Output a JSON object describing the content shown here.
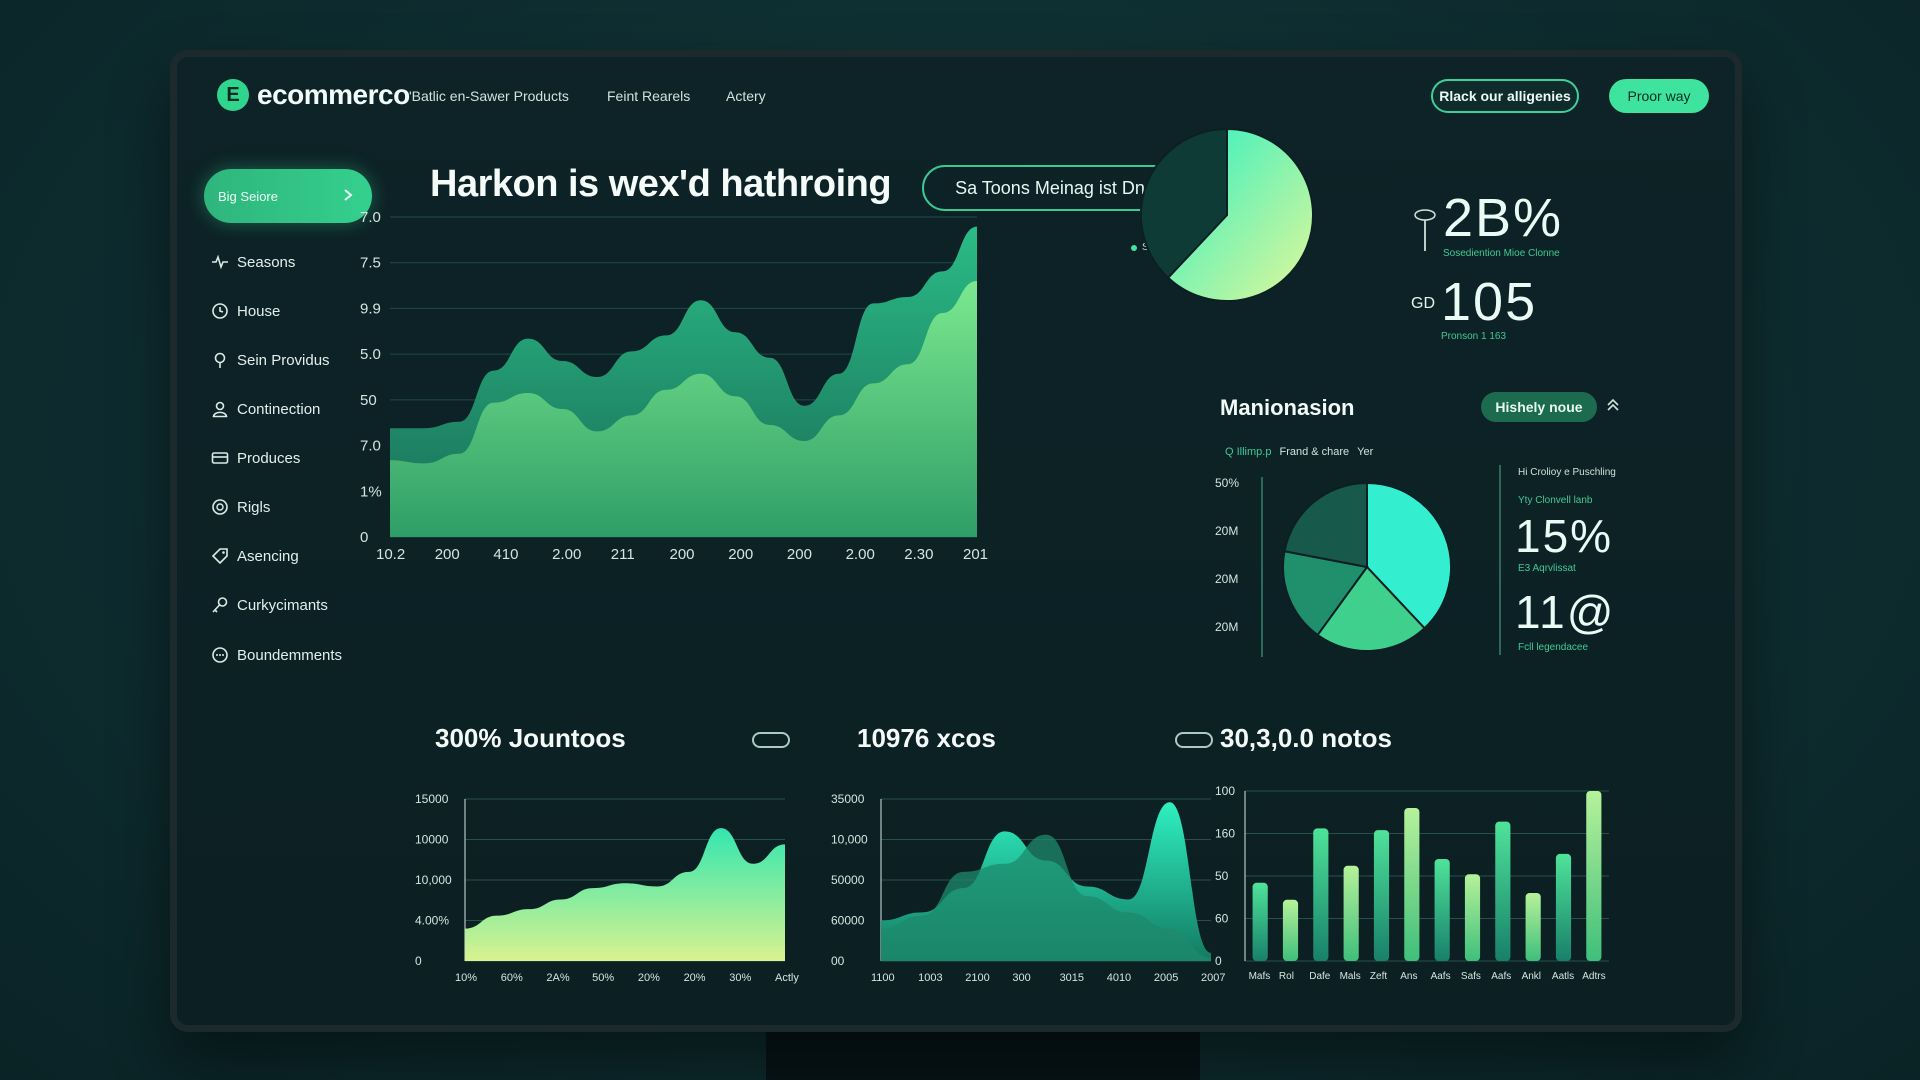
{
  "app": {
    "logo_mark": "E",
    "name": "ecommerco"
  },
  "nav": [
    "'Batlic en-Sawer Products",
    "Feint Rearels",
    "Actery"
  ],
  "header_buttons": {
    "outline": "Rlack our alligenies",
    "solid": "Proor way"
  },
  "sidebar": {
    "cta": "Big Seiore",
    "items": [
      {
        "label": "Seasons",
        "icon": "heartbeat-icon"
      },
      {
        "label": "House",
        "icon": "clock-icon"
      },
      {
        "label": "Sein Providus",
        "icon": "pin-icon"
      },
      {
        "label": "Continection",
        "icon": "user-icon"
      },
      {
        "label": "Produces",
        "icon": "card-icon"
      },
      {
        "label": "Rigls",
        "icon": "badge-icon"
      },
      {
        "label": "Asencing",
        "icon": "tag-icon"
      },
      {
        "label": "Curkycimants",
        "icon": "key-icon"
      },
      {
        "label": "Boundemments",
        "icon": "chat-icon"
      }
    ]
  },
  "main": {
    "title": "Harkon is wex'd hathroing",
    "selector": "Sa Toons Meinag ist Dnain",
    "legend": "Sale Ittiq"
  },
  "chart_data": [
    {
      "type": "area",
      "y_ticks": [
        "7.0",
        "7.5",
        "9.9",
        "5.0",
        "50",
        "7.0",
        "1%",
        "0"
      ],
      "x_ticks": [
        "10.2",
        "200",
        "410",
        "2.00",
        "211",
        "200",
        "200",
        "200",
        "2.00",
        "2.30",
        "201"
      ],
      "series": [
        {
          "name": "Sale Ittiq",
          "values": [
            0.34,
            0.34,
            0.36,
            0.52,
            0.62,
            0.55,
            0.5,
            0.58,
            0.63,
            0.74,
            0.64,
            0.56,
            0.41,
            0.51,
            0.73,
            0.75,
            0.83,
            0.97
          ]
        },
        {
          "values": [
            0.24,
            0.23,
            0.26,
            0.42,
            0.45,
            0.4,
            0.33,
            0.38,
            0.46,
            0.51,
            0.44,
            0.35,
            0.3,
            0.38,
            0.48,
            0.54,
            0.7,
            0.8
          ]
        }
      ]
    },
    {
      "type": "pie",
      "values": [
        62,
        38
      ]
    },
    {
      "type": "pie",
      "values": [
        38,
        22,
        18,
        22
      ],
      "y_ticks": [
        "50%",
        "20M",
        "20M",
        "20M"
      ]
    },
    {
      "type": "area",
      "title": "300% Jountoos",
      "y_ticks": [
        "15000",
        "10000",
        "10,000",
        "4.00%",
        "0"
      ],
      "x_ticks": [
        "10%",
        "60%",
        "2A%",
        "50%",
        "20%",
        "20%",
        "30%",
        "Actly"
      ],
      "values": [
        0.2,
        0.28,
        0.32,
        0.38,
        0.45,
        0.48,
        0.46,
        0.55,
        0.82,
        0.6,
        0.72
      ]
    },
    {
      "type": "area",
      "title": "10976 xcos",
      "y_ticks": [
        "35000",
        "10,000",
        "50000",
        "60000",
        "00"
      ],
      "x_ticks": [
        "1100",
        "1003",
        "2100",
        "300",
        "3015",
        "4010",
        "2005",
        "2007"
      ],
      "series": [
        {
          "values": [
            0.25,
            0.3,
            0.45,
            0.8,
            0.62,
            0.46,
            0.38,
            0.98,
            0.05
          ]
        },
        {
          "values": [
            0.2,
            0.28,
            0.55,
            0.6,
            0.78,
            0.4,
            0.3,
            0.2,
            0.02
          ]
        }
      ]
    },
    {
      "type": "bar",
      "title": "30,3,0.0 notos",
      "y_ticks": [
        "100",
        "160",
        "50",
        "60",
        "0"
      ],
      "x_ticks": [
        "Mafs",
        "Rol",
        "Dafe",
        "Mals",
        "Zeft",
        "Ans",
        "Aafs",
        "Safs",
        "Aafs",
        "Ankl",
        "Aatls",
        "Adtrs"
      ],
      "values": [
        0.46,
        0.36,
        0.78,
        0.56,
        0.77,
        0.9,
        0.6,
        0.51,
        0.82,
        0.4,
        0.63,
        1.0
      ]
    }
  ],
  "stats": [
    {
      "value": "2B%",
      "caption": "Sosediention Mioe Clonne"
    },
    {
      "prefix": "GD",
      "value": "105",
      "caption": "Pronson 1 163"
    },
    {
      "value": "15%",
      "caption": "Hi Crolioy e Puschling",
      "caption2": "Yty Clonvell lanb",
      "caption3": "E3 Aqrvlissat"
    },
    {
      "value": "11@",
      "caption": "Fcll legendacee"
    }
  ],
  "panel": {
    "title": "Manionasion",
    "toggle": "Hishely noue",
    "legend": [
      "Q Illimp.p",
      "Frand & chare",
      "Yer"
    ]
  },
  "colors": {
    "accent": "#3ee39d",
    "dark": "#0c2023"
  }
}
